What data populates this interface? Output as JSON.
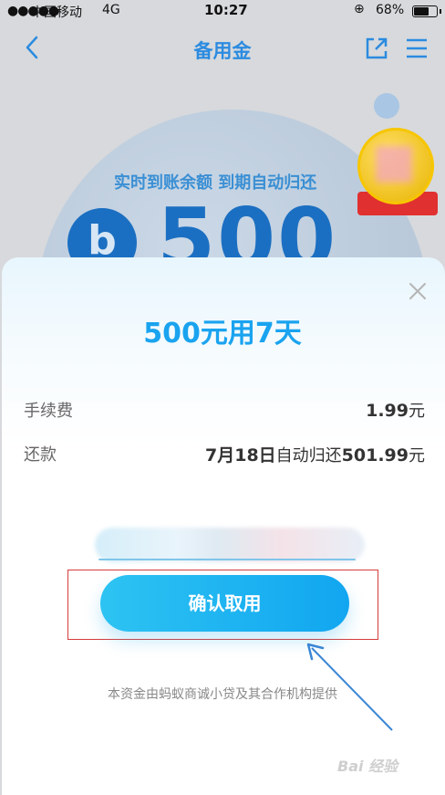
{
  "status_bar": {
    "carrier": "中国移动",
    "network": "4G",
    "time": "10:27",
    "battery_pct": "68%",
    "battery_level": 0.68
  },
  "nav": {
    "title": "备用金",
    "icons": [
      "chevron-left-icon",
      "share-icon",
      "menu-icon"
    ]
  },
  "background": {
    "slogan": "实时到账余额 到期自动归还",
    "amount": "500",
    "currency_glyph": "b"
  },
  "modal": {
    "title": "500元用7天",
    "fee_label": "手续费",
    "fee_value": "1.99",
    "fee_unit": "元",
    "repay_label": "还款",
    "repay_value_prefix": "7月18日",
    "repay_value_mid": "自动归还",
    "repay_amount": "501.99",
    "repay_unit": "元",
    "confirm_label": "确认取用",
    "footer_note": "本资金由蚂蚁商诚小贷及其合作机构提供"
  },
  "watermark": "Bai 经验",
  "colors": {
    "accent": "#1aa3ef",
    "nav_title": "#2b8be0",
    "highlight_border": "#d53c3c"
  }
}
